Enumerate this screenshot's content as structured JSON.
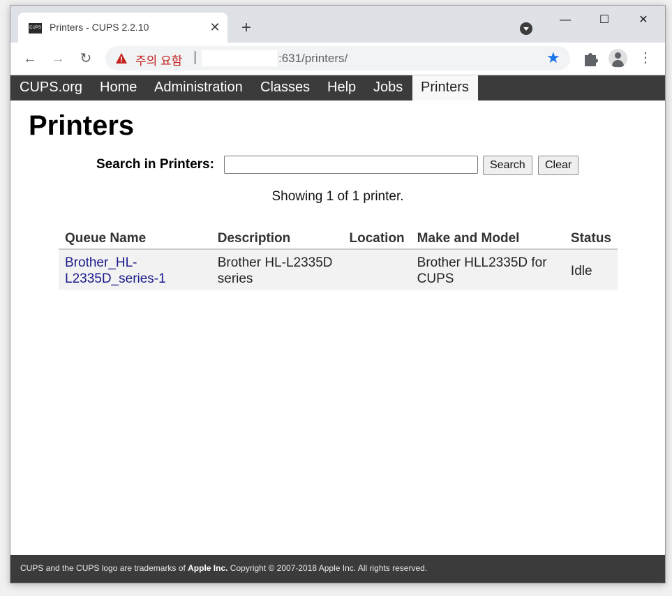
{
  "browser": {
    "tab_title": "Printers - CUPS 2.2.10",
    "favicon_text": "CUPS",
    "close_glyph": "✕",
    "newtab_glyph": "+",
    "minimize_glyph": "—",
    "maximize_glyph": "☐",
    "closewin_glyph": "✕",
    "security_warning": "주의 요함",
    "url_separator": "|",
    "url_path": ":631/printers/",
    "back_glyph": "←",
    "forward_glyph": "→",
    "reload_glyph": "↻",
    "star_glyph": "★",
    "menu_glyph": "⋮",
    "accent_color": "#1a73e8",
    "warning_color": "#c5221f"
  },
  "nav": {
    "items": [
      "CUPS.org",
      "Home",
      "Administration",
      "Classes",
      "Help",
      "Jobs",
      "Printers"
    ],
    "active": "Printers"
  },
  "main": {
    "title": "Printers",
    "search_label": "Search in Printers:",
    "search_value": "",
    "search_button": "Search",
    "clear_button": "Clear",
    "showing": "Showing 1 of 1 printer."
  },
  "table": {
    "headers": [
      "Queue Name",
      "Description",
      "Location",
      "Make and Model",
      "Status"
    ],
    "rows": [
      {
        "queue_line1": "Brother_HL-",
        "queue_line2": "L2335D_series-1",
        "desc_line1": "Brother HL-L2335D",
        "desc_line2": "series",
        "location": "",
        "model_line1": "Brother HLL2335D for",
        "model_line2": "CUPS",
        "status": "Idle"
      }
    ]
  },
  "footer": {
    "prefix": "CUPS and the CUPS logo are trademarks of ",
    "company": "Apple Inc.",
    "suffix": " Copyright © 2007-2018 Apple Inc. All rights reserved."
  }
}
